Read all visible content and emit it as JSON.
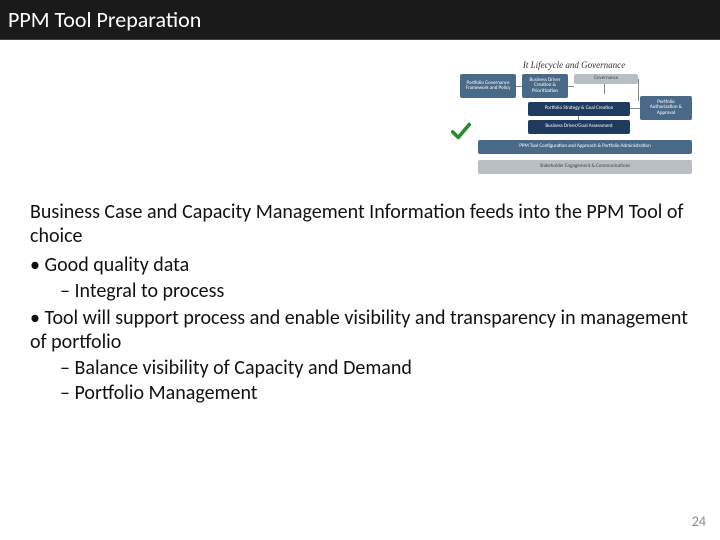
{
  "title": "PPM Tool Preparation",
  "diagram": {
    "header": "It Lifecycle and Governance",
    "boxes": {
      "b1": "Portfolio Governance\nFramework and Policy",
      "b2": "Business Driver\nCreation\n& Prioritization",
      "b3": "Governance",
      "b4": "Portfolio Strategy & Goal Creation",
      "b5": "Portfolio Authorization\n& Approval",
      "b6": "Business Driver/Goal Assessment",
      "b7": "PPM Tool Configuration and Approach & Portfolio Administration",
      "b8": "Stakeholder Engagement & Communications"
    }
  },
  "content": {
    "intro": "Business Case and Capacity Management Information feeds into the PPM Tool of choice",
    "bullets": [
      {
        "text": "Good quality data",
        "sub": [
          "Integral to process"
        ]
      },
      {
        "text": "Tool will support process and enable visibility and transparency in management of portfolio",
        "sub": [
          "Balance visibility of Capacity and Demand",
          "Portfolio Management"
        ]
      }
    ]
  },
  "page_number": "24"
}
